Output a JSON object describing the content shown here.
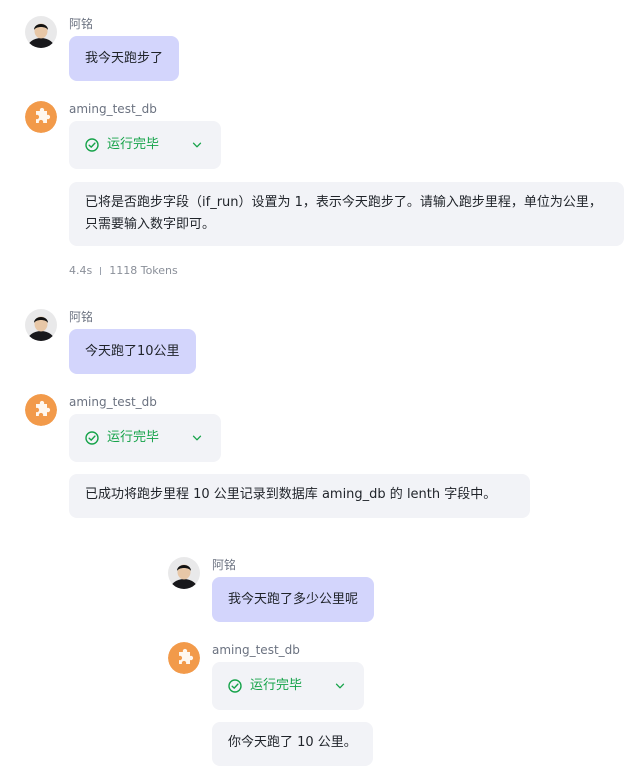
{
  "user_name": "阿铭",
  "bot_name": "aming_test_db",
  "status_label": "运行完毕",
  "accent_user_bubble": "#d3d5fc",
  "accent_status": "#16a34a",
  "icons": {
    "bot_avatar": "puzzle-icon",
    "status": "check-circle-icon",
    "expand": "chevron-down-icon"
  },
  "conversation": [
    {
      "user_text": "我今天跑步了",
      "bot_text": "已将是否跑步字段（if_run）设置为 1，表示今天跑步了。请输入跑步里程，单位为公里，只需要输入数字即可。",
      "meta": {
        "duration": "4.4s",
        "tokens": "1118 Tokens"
      }
    },
    {
      "user_text": "今天跑了10公里",
      "bot_text": "已成功将跑步里程 10 公里记录到数据库 aming_db 的 lenth 字段中。"
    },
    {
      "user_text": "我今天跑了多少公里呢",
      "bot_text": "你今天跑了 10 公里。"
    }
  ]
}
